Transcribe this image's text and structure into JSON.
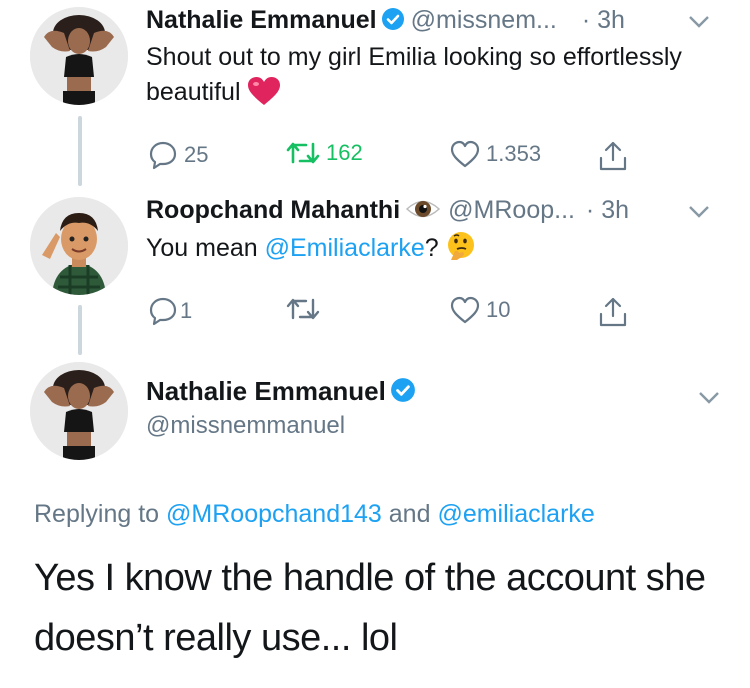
{
  "tweets": [
    {
      "author": {
        "name": "Nathalie Emmanuel",
        "handle": "@missnem...",
        "verified": true
      },
      "time": "· 3h",
      "text": "Shout out to my girl Emilia looking so effortlessly beautiful",
      "emoji": "heart-emoji",
      "actions": {
        "replies": "25",
        "retweets": "162",
        "likes": "1.353"
      }
    },
    {
      "author": {
        "name": "Roopchand Mahanthi",
        "handle": "@MRoop...",
        "badge": "eye-emoji"
      },
      "time": "· 3h",
      "text_prefix": "You mean ",
      "mention": "@Emiliaclarke",
      "text_suffix": "?",
      "emoji": "thinking-face-emoji",
      "actions": {
        "replies": "1",
        "retweets": "",
        "likes": "10"
      }
    }
  ],
  "main_tweet": {
    "author": {
      "name": "Nathalie Emmanuel",
      "handle": "@missnemmanuel",
      "verified": true
    },
    "replying_prefix": "Replying to ",
    "replying_to": [
      "@MRoopchand143",
      "@emiliaclarke"
    ],
    "replying_and": " and ",
    "text": "Yes I know the handle of the account she doesn’t really use... lol"
  },
  "colors": {
    "accent": "#1da1f2",
    "muted": "#657786",
    "retweet": "#17bf63",
    "heart": "#e0245e",
    "line": "#ccd6dd"
  }
}
